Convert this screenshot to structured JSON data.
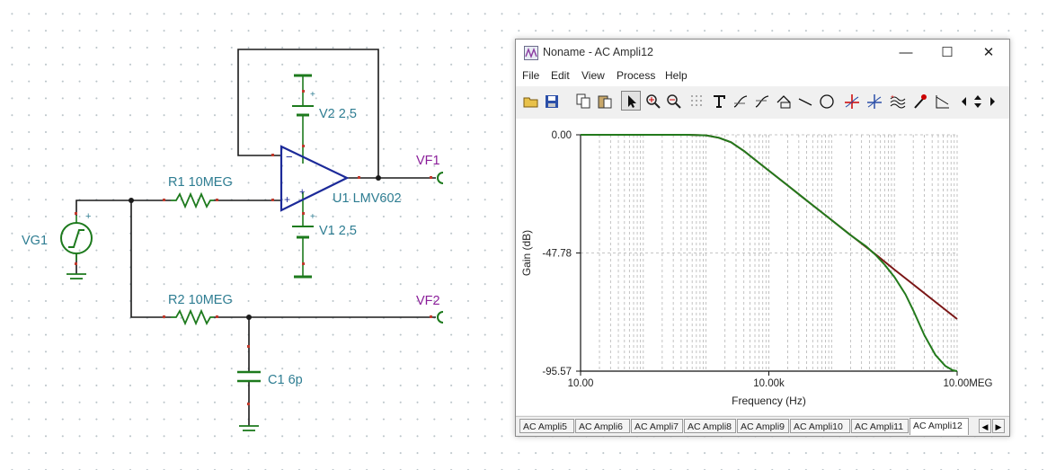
{
  "schematic": {
    "source_label": "VG1",
    "r1_label": "R1 10MEG",
    "r2_label": "R2 10MEG",
    "v2_label": "V2 2,5",
    "v1_label": "V1 2,5",
    "opamp_label": "U1 LMV602",
    "c1_label": "C1 6p",
    "vf1_label": "VF1",
    "vf2_label": "VF2",
    "plus_sign": "+",
    "minus_sign": "−",
    "wire_color": "#1a1a1a",
    "component_color": "#1d7a1d",
    "opamp_color": "#1c2a99"
  },
  "window": {
    "title": "Noname - AC Ampli12",
    "controls": {
      "minimize": "—",
      "maximize": "☐",
      "close": "✕"
    },
    "menu": [
      "File",
      "Edit",
      "View",
      "Process",
      "Help"
    ],
    "toolbar_icons": [
      "open-icon",
      "save-icon",
      "copy-icon",
      "paste-icon",
      "select-arrow-icon",
      "zoom-in-icon",
      "zoom-out-icon",
      "grid-icon",
      "text-icon",
      "draw-curve-icon",
      "draw-curve2-icon",
      "zoom-area-icon",
      "line-icon",
      "circle-icon",
      "cursor-a-icon",
      "cursor-b-icon",
      "waveform-icon",
      "marker-icon",
      "slope-icon",
      "scroll-left-icon",
      "scroll-updown-icon",
      "scroll-right-icon"
    ],
    "active_tab": "AC Ampli12",
    "tabs": [
      "AC Ampli5",
      "AC Ampli6",
      "AC Ampli7",
      "AC Ampli8",
      "AC Ampli9",
      "AC Ampli10",
      "AC Ampli11",
      "AC Ampli12"
    ],
    "tab_scroll": {
      "left": "◀",
      "right": "▶"
    }
  },
  "chart_data": {
    "type": "line",
    "xlabel": "Frequency (Hz)",
    "ylabel": "Gain (dB)",
    "x_scale": "log",
    "xlim": [
      10,
      10000000
    ],
    "ylim": [
      -95.57,
      0
    ],
    "x_tick_labels": [
      {
        "value": 10,
        "label": "10.00"
      },
      {
        "value": 10000,
        "label": "10.00k"
      },
      {
        "value": 10000000,
        "label": "10.00MEG"
      }
    ],
    "y_tick_labels": [
      {
        "value": 0,
        "label": "0.00"
      },
      {
        "value": -47.78,
        "label": "-47.78"
      },
      {
        "value": -95.57,
        "label": "-95.57"
      }
    ],
    "grid": true,
    "series": [
      {
        "color": "#7a1616",
        "points": [
          [
            10,
            0
          ],
          [
            100,
            0
          ],
          [
            500,
            0
          ],
          [
            1000,
            -0.2
          ],
          [
            1600,
            -1.2
          ],
          [
            2500,
            -3.0
          ],
          [
            4000,
            -6.5
          ],
          [
            6300,
            -10.5
          ],
          [
            10000,
            -14.5
          ],
          [
            20000,
            -20.5
          ],
          [
            50000,
            -28.5
          ],
          [
            100000,
            -34.5
          ],
          [
            200000,
            -40.5
          ],
          [
            500000,
            -48.3
          ],
          [
            1000000,
            -54.5
          ],
          [
            2000000,
            -60.5
          ],
          [
            5000000,
            -68.5
          ],
          [
            10000000,
            -74.5
          ]
        ]
      },
      {
        "color": "#237a1c",
        "points": [
          [
            10,
            0
          ],
          [
            100,
            0
          ],
          [
            500,
            0
          ],
          [
            1000,
            -0.2
          ],
          [
            1600,
            -1.2
          ],
          [
            2500,
            -3.0
          ],
          [
            4000,
            -6.5
          ],
          [
            6300,
            -10.5
          ],
          [
            10000,
            -14.5
          ],
          [
            20000,
            -20.5
          ],
          [
            50000,
            -28.5
          ],
          [
            100000,
            -34.5
          ],
          [
            200000,
            -40.6
          ],
          [
            350000,
            -45.0
          ],
          [
            500000,
            -48.5
          ],
          [
            700000,
            -52.5
          ],
          [
            1000000,
            -57.5
          ],
          [
            1500000,
            -64.5
          ],
          [
            2000000,
            -71.0
          ],
          [
            3000000,
            -81.0
          ],
          [
            4500000,
            -89.0
          ],
          [
            6500000,
            -93.5
          ],
          [
            8500000,
            -95.2
          ],
          [
            10000000,
            -95.57
          ]
        ]
      }
    ]
  }
}
